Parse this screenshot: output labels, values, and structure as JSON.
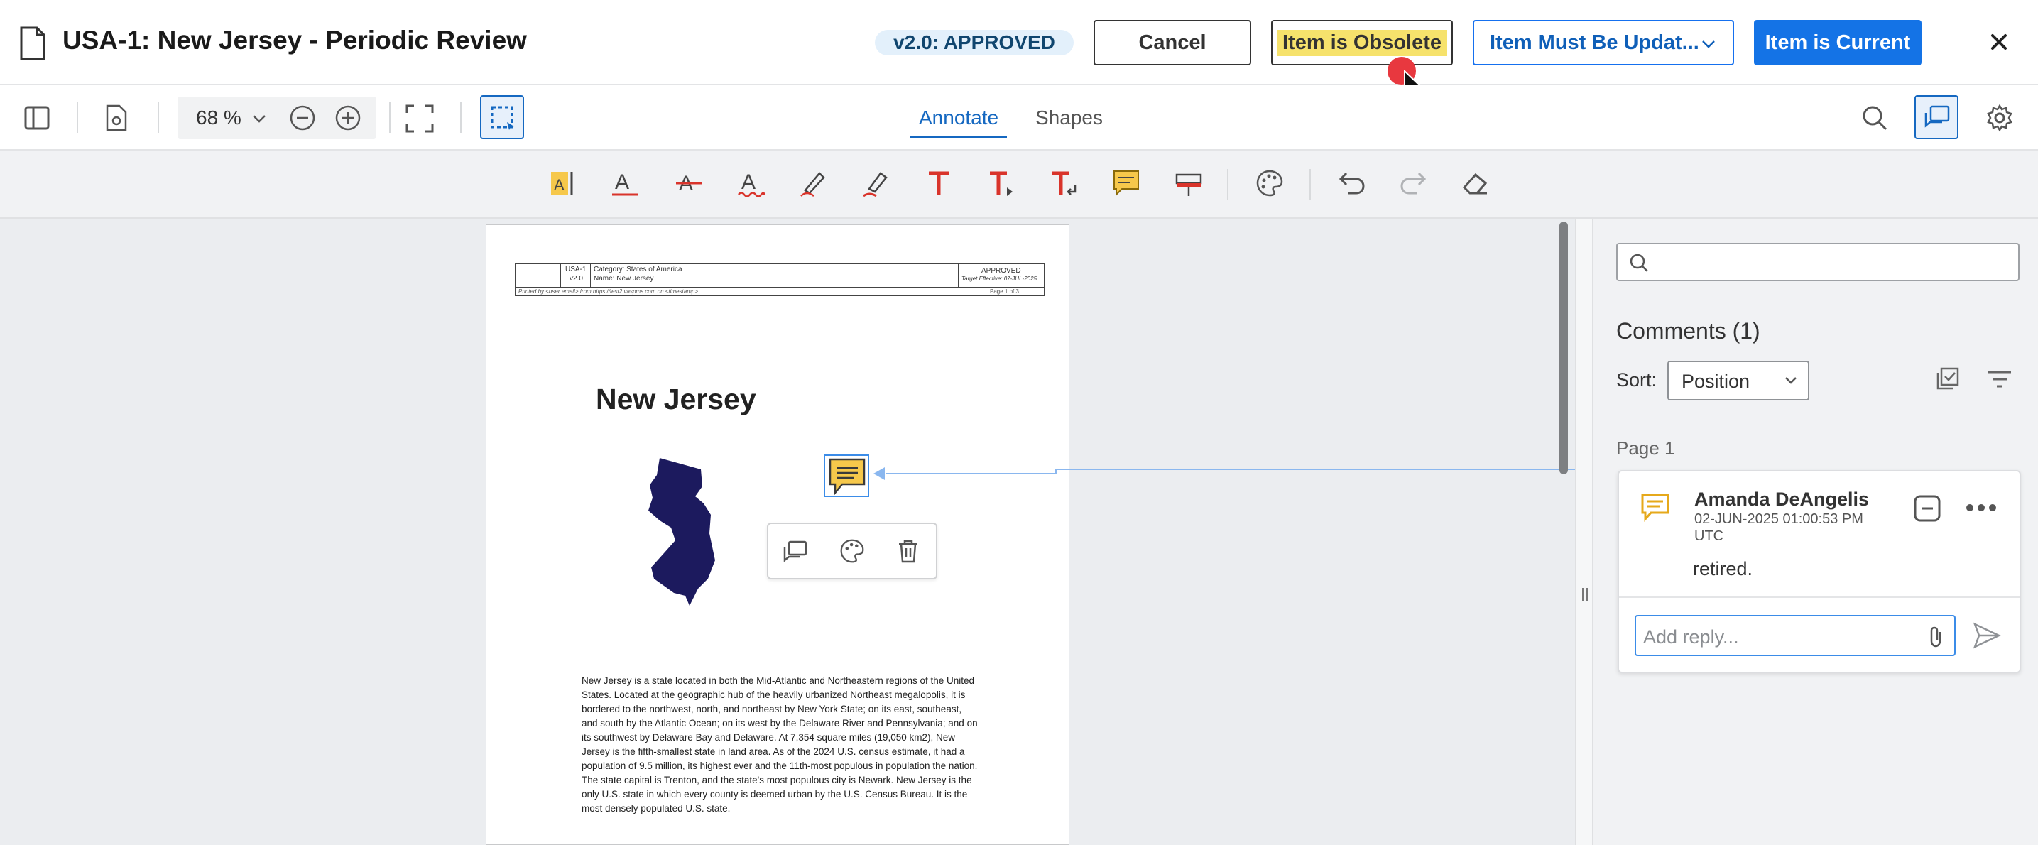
{
  "header": {
    "title": "USA-1: New Jersey - Periodic Review",
    "status": "v2.0: APPROVED",
    "cancel_label": "Cancel",
    "obsolete_label": "Item is Obsolete",
    "update_label": "Item Must Be Updat...",
    "current_label": "Item is Current",
    "accent_color": "#1473e6"
  },
  "toolbar": {
    "zoom": "68 %",
    "tabs": [
      "Annotate",
      "Shapes"
    ],
    "active_tab": "Annotate",
    "icons": [
      "sidebar-toggle-icon",
      "document-settings-icon",
      "zoom-out-icon",
      "zoom-in-icon",
      "fit-screen-icon",
      "select-area-icon",
      "search-icon",
      "comments-panel-icon",
      "settings-icon"
    ]
  },
  "annotation_tools": [
    "highlight-text-icon",
    "underline-text-icon",
    "strikeout-text-icon",
    "squiggly-text-icon",
    "freehand-icon",
    "freehand-highlight-icon",
    "free-text-icon",
    "insert-text-icon",
    "replace-text-icon",
    "sticky-note-icon",
    "redact-icon",
    "color-palette-icon",
    "undo-icon",
    "redo-icon",
    "eraser-icon"
  ],
  "document": {
    "header_id": "USA-1",
    "header_version": "v2.0",
    "header_category": "Category: States of America",
    "header_name": "Name: New Jersey",
    "header_status": "APPROVED",
    "header_effective": "Target Effective: 07-JUL-2025",
    "header_printed": "Printed by <user email> from https://test2.vaspms.com on <timestamp>",
    "header_page": "Page 1 of 3",
    "heading": "New Jersey",
    "body": "New Jersey is a state located in both the Mid-Atlantic and Northeastern regions of the United States. Located at the geographic hub of the heavily urbanized Northeast megalopolis, it is bordered to the northwest, north, and northeast by New York State; on its east, southeast, and south by the Atlantic Ocean; on its west by the Delaware River and Pennsylvania; and on its southwest by Delaware Bay and Delaware. At 7,354 square miles (19,050 km2), New Jersey is the fifth-smallest state in land area. As of the 2024 U.S. census estimate, it had a population of 9.5 million, its highest ever and the 11th-most populous in population the nation. The state capital is Trenton, and the state's most populous city is Newark. New Jersey is the only U.S. state in which every county is deemed urban by the U.S. Census Bureau. It is the most densely populated U.S. state.",
    "map_color": "#1c1a5e"
  },
  "panel": {
    "search_placeholder": "",
    "comments_heading": "Comments (1)",
    "sort_label": "Sort:",
    "sort_value": "Position",
    "page_label": "Page 1",
    "comment": {
      "author": "Amanda DeAngelis",
      "timestamp_line1": "02-JUN-2025 01:00:53 PM",
      "timestamp_line2": "UTC",
      "text": "retired."
    },
    "reply_placeholder": "Add reply..."
  }
}
